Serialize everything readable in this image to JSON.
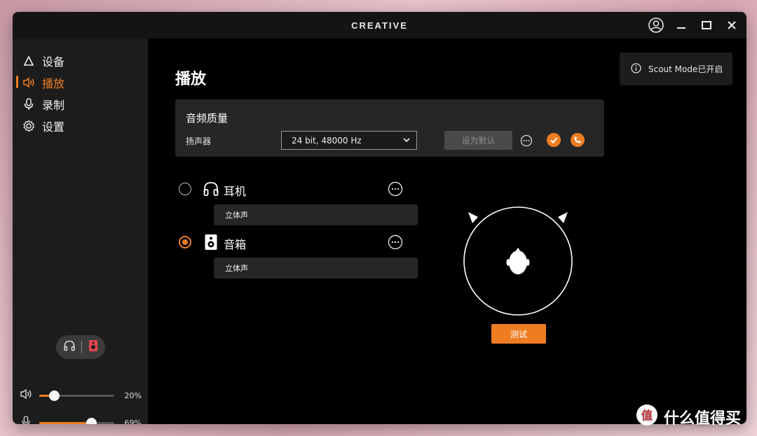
{
  "app": {
    "brand": "CREATIVE"
  },
  "sidebar": {
    "items": [
      {
        "label": "设备",
        "icon": "device-triangle-icon"
      },
      {
        "label": "播放",
        "icon": "speaker-icon",
        "active": true
      },
      {
        "label": "录制",
        "icon": "microphone-icon"
      },
      {
        "label": "设置",
        "icon": "gear-icon"
      }
    ],
    "output_toggle": {
      "options": [
        "headphones-icon",
        "speaker-box-icon"
      ]
    },
    "volume": {
      "value_label": "20%",
      "value": 0.2
    },
    "mic": {
      "value_label": "69%",
      "value": 0.69
    }
  },
  "main": {
    "title": "播放",
    "scout": {
      "label": "Scout Mode已开启",
      "icon": "info-icon"
    },
    "quality": {
      "title": "音频质量",
      "label": "扬声器",
      "select_value": "24 bit, 48000 Hz",
      "default_button": "设为默认"
    },
    "devices": [
      {
        "label": "耳机",
        "icon": "headphones-icon",
        "selected": false,
        "mode": "立体声"
      },
      {
        "label": "音箱",
        "icon": "speaker-box-icon",
        "selected": true,
        "mode": "立体声"
      }
    ],
    "test_button": "测试"
  },
  "colors": {
    "accent": "#ee7d22",
    "sidebar": "#1c1c1c",
    "card": "#262626"
  },
  "watermark": {
    "text": "什么值得买"
  }
}
